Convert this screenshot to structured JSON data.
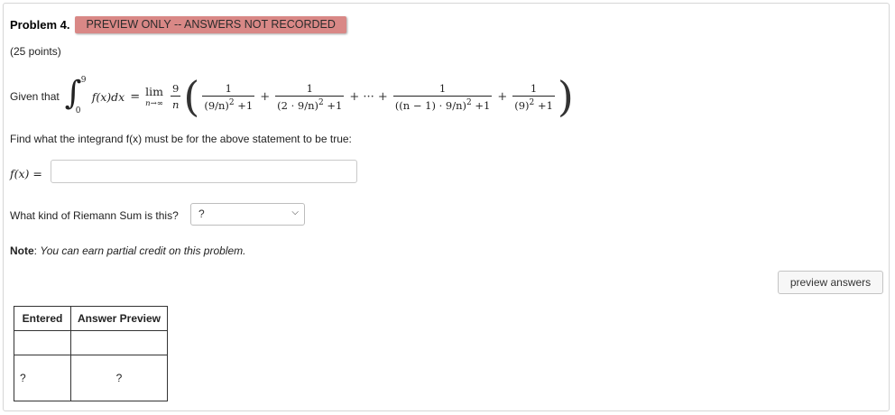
{
  "problem": {
    "title": "Problem 4.",
    "badge": "PREVIEW ONLY -- ANSWERS NOT RECORDED",
    "points": "(25 points)"
  },
  "statement": {
    "given_label": "Given that",
    "integral_upper": "9",
    "integral_lower": "0",
    "integrand": "f(x)dx",
    "equals": "=",
    "lim_label": "lim",
    "lim_sub": "n→∞",
    "coef_num": "9",
    "coef_den": "n",
    "terms": [
      {
        "num": "1",
        "den_base": "(9/n)",
        "den_pow": "2",
        "den_tail": "+1"
      },
      {
        "num": "1",
        "den_base": "(2 · 9/n)",
        "den_pow": "2",
        "den_tail": "+1"
      },
      {
        "num": "1",
        "den_base": "((n − 1) · 9/n)",
        "den_pow": "2",
        "den_tail": "+1"
      },
      {
        "num": "1",
        "den_base": "(9)",
        "den_pow": "2",
        "den_tail": "+1"
      }
    ],
    "plus": "+",
    "ellipsis_plus": "+ ··· +"
  },
  "question1": {
    "text": "Find what the integrand f(x) must be for the above statement to be true:",
    "label": "f(x) =",
    "value": ""
  },
  "question2": {
    "text": "What kind of Riemann Sum is this?",
    "selected": "?"
  },
  "note": {
    "bold": "Note",
    "sep": ":",
    "italic": "You can earn partial credit on this problem."
  },
  "buttons": {
    "preview": "preview answers"
  },
  "table": {
    "headers": [
      "Entered",
      "Answer Preview"
    ],
    "rows": [
      [
        "",
        ""
      ],
      [
        "?",
        "?"
      ]
    ]
  }
}
